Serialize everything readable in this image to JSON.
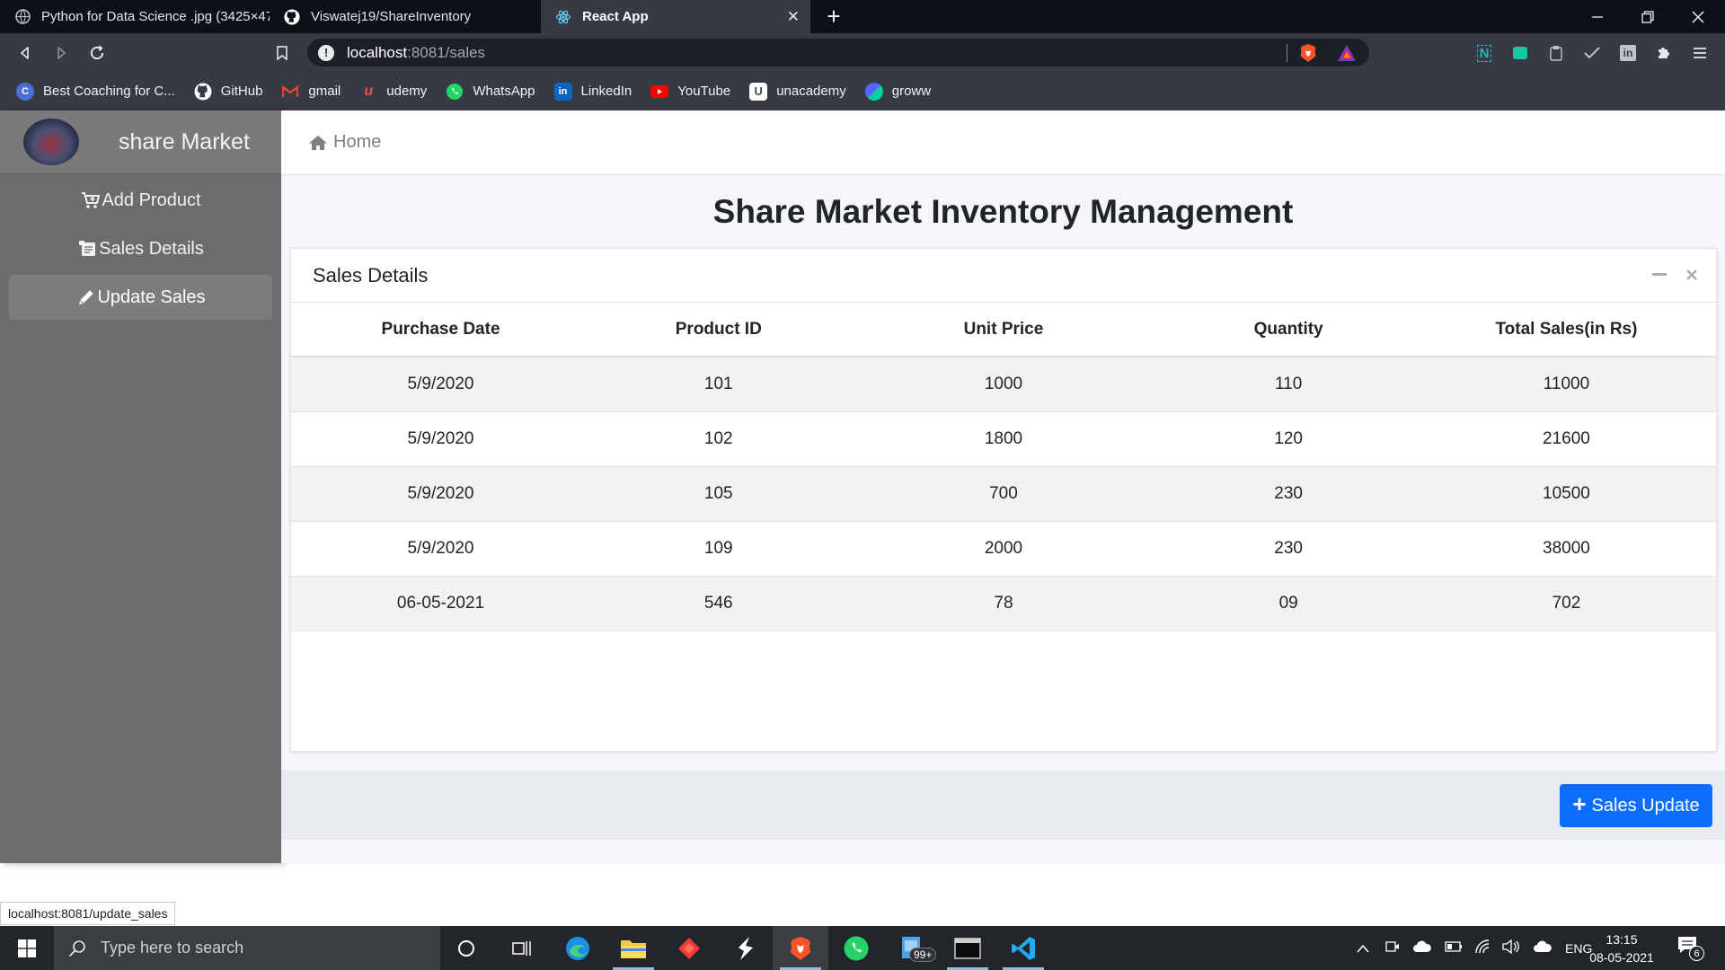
{
  "browser": {
    "tabs": [
      {
        "title": "Python for Data Science .jpg (3425×47",
        "active": false
      },
      {
        "title": "Viswatej19/ShareInventory",
        "active": false
      },
      {
        "title": "React App",
        "active": true
      }
    ],
    "url_host": "localhost",
    "url_rest": ":8081/sales",
    "bookmarks": [
      {
        "label": "Best Coaching for C...",
        "icon": "coaching-icon",
        "color": "#4a6fd6"
      },
      {
        "label": "GitHub",
        "icon": "github-icon",
        "color": "#ffffff"
      },
      {
        "label": "gmail",
        "icon": "gmail-icon",
        "color": "#ea4335"
      },
      {
        "label": "udemy",
        "icon": "udemy-icon",
        "color": "#ec5252"
      },
      {
        "label": "WhatsApp",
        "icon": "whatsapp-icon",
        "color": "#25d366"
      },
      {
        "label": "LinkedIn",
        "icon": "linkedin-icon",
        "color": "#0a66c2"
      },
      {
        "label": "YouTube",
        "icon": "youtube-icon",
        "color": "#ff0000"
      },
      {
        "label": "unacademy",
        "icon": "unacademy-icon",
        "color": "#3c4852"
      },
      {
        "label": "groww",
        "icon": "groww-icon",
        "color": "#5367ff"
      }
    ]
  },
  "sidebar": {
    "brand": "share Market",
    "items": [
      {
        "label": "Add Product",
        "icon": "cart-plus-icon",
        "active": false
      },
      {
        "label": "Sales Details",
        "icon": "receipt-icon",
        "active": false
      },
      {
        "label": "Update Sales",
        "icon": "pencil-icon",
        "active": true
      }
    ]
  },
  "topnav": {
    "home_label": "Home"
  },
  "page": {
    "title": "Share Market Inventory Management"
  },
  "card": {
    "title": "Sales Details",
    "columns": [
      "Purchase Date",
      "Product ID",
      "Unit Price",
      "Quantity",
      "Total Sales(in Rs)"
    ],
    "rows": [
      [
        "5/9/2020",
        "101",
        "1000",
        "110",
        "11000"
      ],
      [
        "5/9/2020",
        "102",
        "1800",
        "120",
        "21600"
      ],
      [
        "5/9/2020",
        "105",
        "700",
        "230",
        "10500"
      ],
      [
        "5/9/2020",
        "109",
        "2000",
        "230",
        "38000"
      ],
      [
        "06-05-2021",
        "546",
        "78",
        "09",
        "702"
      ]
    ]
  },
  "actions": {
    "sales_update_label": "Sales Update",
    "accent": "#0d6efd"
  },
  "status_url": "localhost:8081/update_sales",
  "taskbar": {
    "search_placeholder": "Type here to search",
    "mail_badge": "99+",
    "language": "ENG",
    "time": "13:15",
    "date": "08-05-2021",
    "notification_count": "6"
  }
}
